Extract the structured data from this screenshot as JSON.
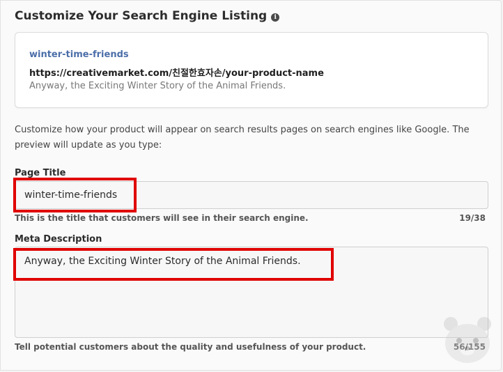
{
  "header": {
    "title": "Customize Your Search Engine Listing",
    "info_icon": "i"
  },
  "preview": {
    "title": "winter-time-friends",
    "url": "https://creativemarket.com/친절한효자손/your-product-name",
    "description": "Anyway, the Exciting Winter Story of the Animal Friends."
  },
  "intro_text": "Customize how your product will appear on search results pages on search engines like Google. The preview will update as you type:",
  "page_title": {
    "label": "Page Title",
    "value": "winter-time-friends",
    "helper": "This is the title that customers will see in their search engine.",
    "counter": "19/38"
  },
  "meta_description": {
    "label": "Meta Description",
    "value": "Anyway, the Exciting Winter Story of the Animal Friends.",
    "helper": "Tell potential customers about the quality and usefulness of your product.",
    "counter": "56/155"
  },
  "colors": {
    "highlight": "#e00000",
    "link": "#4b6ea8"
  }
}
